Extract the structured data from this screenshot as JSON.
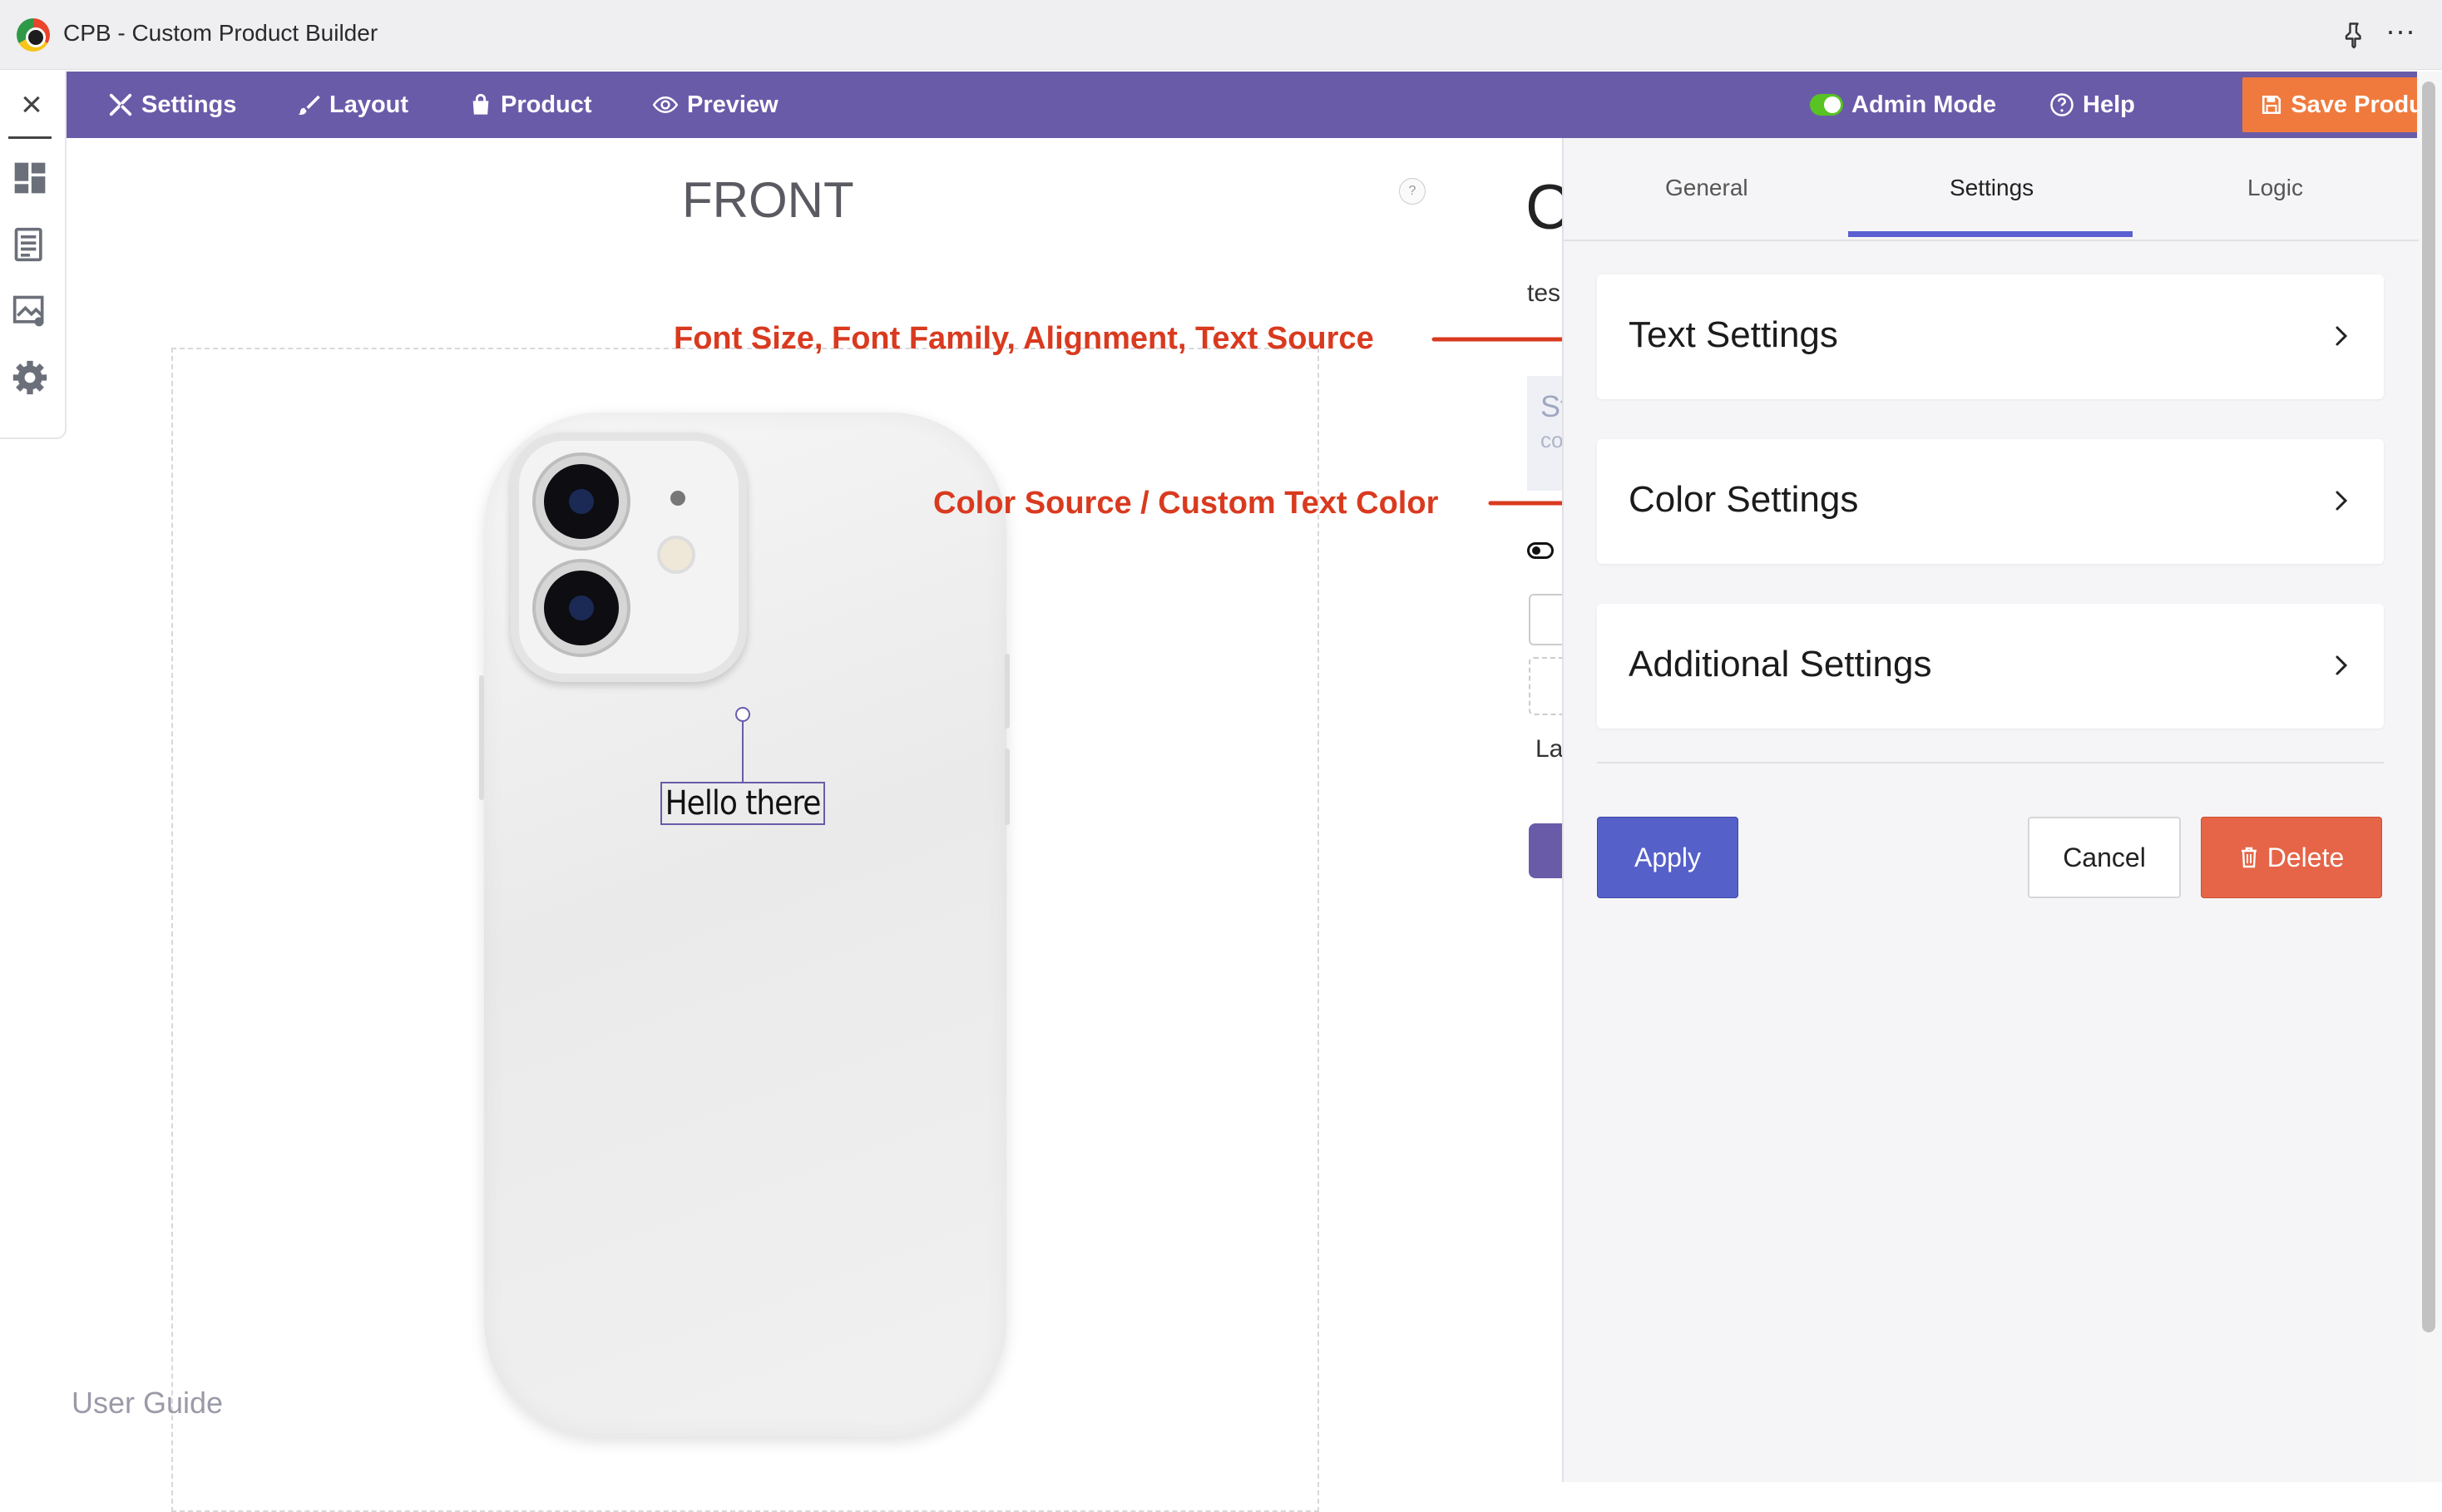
{
  "window": {
    "title": "CPB - Custom Product Builder",
    "logo_icon": "cpb-logo-icon",
    "pin_icon": "pin-icon",
    "more_icon": "more-horizontal-icon"
  },
  "left_rail": {
    "close_icon": "close-icon",
    "items": [
      "dashboard-icon",
      "list-icon",
      "gallery-icon",
      "gear-icon"
    ]
  },
  "toolbar": {
    "settings_label": "Settings",
    "layout_label": "Layout",
    "product_label": "Product",
    "preview_label": "Preview",
    "admin_mode_label": "Admin Mode",
    "help_label": "Help",
    "save_label": "Save Product",
    "bg_color": "#6a5ba9",
    "save_color": "#f07a3d",
    "toggle_color": "#58c322"
  },
  "canvas": {
    "side_label": "FRONT",
    "help_badge": "?",
    "text_layer": "Hello there",
    "user_guide": "User Guide"
  },
  "background_panel": {
    "heading_peek": "C",
    "text_peek": "tes",
    "field_peek_1": "St",
    "field_peek_2": "co",
    "label_peek": "La"
  },
  "annotations": {
    "text_settings_note": "Font Size, Font Family, Alignment, Text Source",
    "color_settings_note": "Color Source / Custom Text Color",
    "color": "#d93a1f"
  },
  "panel": {
    "tabs": [
      "General",
      "Settings",
      "Logic"
    ],
    "active_tab": "Settings",
    "sections": [
      "Text Settings",
      "Color Settings",
      "Additional Settings"
    ],
    "apply_label": "Apply",
    "cancel_label": "Cancel",
    "delete_label": "Delete",
    "apply_color": "#5660c9",
    "delete_color": "#e66548"
  }
}
